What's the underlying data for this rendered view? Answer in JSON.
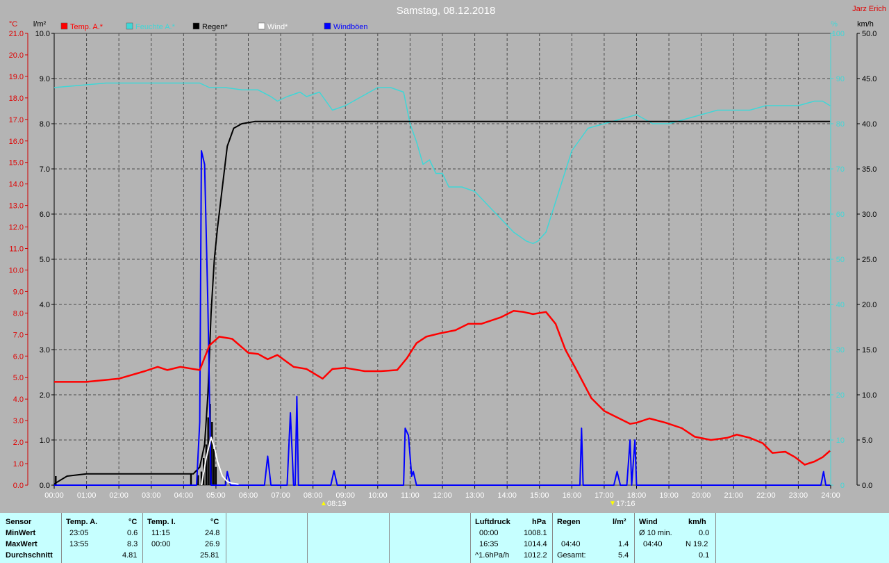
{
  "title": "Samstag, 08.12.2018",
  "author": "Jarz Erich",
  "colors": {
    "bg": "#b4b4b4",
    "temp": "#ff0000",
    "humidity": "#3fd7d7",
    "rain": "#000000",
    "wind": "#ffffff",
    "gust": "#0000ff",
    "stats_bg": "#c6ffff"
  },
  "chart_data": {
    "type": "line",
    "x_axis": {
      "range": [
        "00:00",
        "24:00"
      ],
      "ticks": [
        "00:00",
        "01:00",
        "02:00",
        "03:00",
        "04:00",
        "05:00",
        "06:00",
        "07:00",
        "08:00",
        "09:00",
        "10:00",
        "11:00",
        "12:00",
        "13:00",
        "14:00",
        "15:00",
        "16:00",
        "17:00",
        "18:00",
        "19:00",
        "20:00",
        "21:00",
        "22:00",
        "23:00",
        "24:00"
      ],
      "sunrise": "08:19",
      "sunset": "17:16"
    },
    "y_axes": {
      "temp": {
        "unit": "°C",
        "range": [
          0,
          21
        ],
        "ticks": [
          "0.0",
          "1.0",
          "2.0",
          "3.0",
          "4.0",
          "5.0",
          "6.0",
          "7.0",
          "8.0",
          "9.0",
          "10.0",
          "11.0",
          "12.0",
          "13.0",
          "14.0",
          "15.0",
          "16.0",
          "17.0",
          "18.0",
          "19.0",
          "20.0",
          "21.0"
        ]
      },
      "rain": {
        "unit": "l/m²",
        "range": [
          0,
          10
        ],
        "ticks": [
          "0.0",
          "1.0",
          "2.0",
          "3.0",
          "4.0",
          "5.0",
          "6.0",
          "7.0",
          "8.0",
          "9.0",
          "10.0"
        ]
      },
      "humidity": {
        "unit": "%",
        "range": [
          0,
          100
        ],
        "ticks": [
          "0",
          "10",
          "20",
          "30",
          "40",
          "50",
          "60",
          "70",
          "80",
          "90",
          "100"
        ]
      },
      "wind": {
        "unit": "km/h",
        "range": [
          0,
          50
        ],
        "ticks": [
          "0.0",
          "5.0",
          "10.0",
          "15.0",
          "20.0",
          "25.0",
          "30.0",
          "35.0",
          "40.0",
          "45.0",
          "50.0"
        ]
      }
    },
    "legend": [
      {
        "name": "Temp. A.*",
        "color": "#ff0000"
      },
      {
        "name": "Feuchte A.*",
        "color": "#3fd7d7"
      },
      {
        "name": "Regen*",
        "color": "#000000"
      },
      {
        "name": "Wind*",
        "color": "#ffffff"
      },
      {
        "name": "Windböen",
        "color": "#0000ff"
      }
    ],
    "series": [
      {
        "name": "Temp. A.*",
        "axis": "temp",
        "color": "#ff0000",
        "x": [
          0,
          1,
          2,
          2.8,
          3.2,
          3.5,
          3.9,
          4.5,
          4.8,
          5.1,
          5.5,
          6.0,
          6.3,
          6.6,
          6.9,
          7.4,
          7.8,
          8.3,
          8.6,
          9.0,
          9.6,
          10.1,
          10.6,
          10.9,
          11.2,
          11.5,
          11.9,
          12.4,
          12.8,
          13.2,
          13.8,
          14.2,
          14.5,
          14.8,
          15.2,
          15.5,
          15.8,
          16.2,
          16.6,
          17.0,
          17.4,
          17.8,
          18.0,
          18.4,
          18.9,
          19.4,
          19.8,
          20.3,
          20.8,
          21.1,
          21.5,
          21.9,
          22.2,
          22.6,
          22.9,
          23.2,
          23.5,
          23.75,
          23.98
        ],
        "y": [
          4.8,
          4.8,
          4.95,
          5.3,
          5.5,
          5.35,
          5.5,
          5.35,
          6.5,
          6.9,
          6.8,
          6.15,
          6.1,
          5.85,
          6.05,
          5.5,
          5.4,
          4.95,
          5.4,
          5.45,
          5.3,
          5.3,
          5.35,
          5.9,
          6.6,
          6.9,
          7.05,
          7.2,
          7.5,
          7.5,
          7.8,
          8.1,
          8.05,
          7.95,
          8.05,
          7.5,
          6.3,
          5.2,
          4.05,
          3.45,
          3.15,
          2.85,
          2.9,
          3.1,
          2.9,
          2.65,
          2.25,
          2.1,
          2.2,
          2.35,
          2.2,
          1.95,
          1.5,
          1.55,
          1.3,
          0.95,
          1.1,
          1.3,
          1.6
        ]
      },
      {
        "name": "Feuchte A.*",
        "axis": "humidity",
        "color": "#3fd7d7",
        "x": [
          0,
          0.8,
          1.6,
          2.5,
          3.3,
          4.3,
          4.5,
          4.8,
          5.3,
          5.8,
          6.3,
          6.7,
          6.9,
          7.2,
          7.6,
          7.8,
          8.2,
          8.5,
          8.6,
          9.0,
          9.5,
          10.0,
          10.4,
          10.8,
          11.0,
          11.2,
          11.4,
          11.6,
          11.8,
          12.0,
          12.2,
          12.6,
          13.0,
          13.4,
          13.8,
          14.2,
          14.6,
          14.8,
          14.95,
          15.2,
          15.6,
          16.0,
          16.5,
          17.0,
          17.5,
          18.0,
          18.5,
          19.0,
          19.5,
          20.0,
          20.5,
          21.0,
          21.5,
          22.0,
          22.5,
          23.0,
          23.5,
          23.75,
          23.98
        ],
        "y": [
          88,
          88.5,
          89,
          89,
          89,
          89,
          89,
          88,
          88,
          87.5,
          87.5,
          86,
          85,
          86,
          87,
          86,
          87,
          84,
          83,
          84,
          86,
          88,
          88,
          87,
          80,
          76,
          71,
          72,
          69,
          69,
          66,
          66,
          65,
          62,
          59,
          56,
          54,
          53.5,
          54,
          56,
          65,
          74,
          79,
          80,
          81,
          82,
          80,
          80,
          81,
          82,
          83,
          83,
          83,
          84,
          84,
          84,
          85,
          85,
          84
        ]
      },
      {
        "name": "Regen*",
        "axis": "rain",
        "color": "#000000",
        "x": [
          0,
          0.05,
          0.4,
          1.0,
          2.0,
          3.0,
          4.0,
          4.3,
          4.5,
          4.65,
          4.75,
          4.85,
          4.95,
          5.05,
          5.2,
          5.35,
          5.55,
          5.8,
          6.2,
          7,
          10,
          15,
          20,
          23.98
        ],
        "y": [
          0,
          0.05,
          0.2,
          0.25,
          0.25,
          0.25,
          0.25,
          0.25,
          0.4,
          0.9,
          2.0,
          3.8,
          5.0,
          5.7,
          6.6,
          7.5,
          7.9,
          8.0,
          8.05,
          8.05,
          8.05,
          8.05,
          8.05,
          8.05
        ]
      },
      {
        "name": "Regen-Balken",
        "axis": "rain",
        "color": "#000000",
        "x": [
          0.05,
          4.23,
          4.45,
          4.55,
          4.62,
          4.7,
          4.76,
          4.82,
          4.88,
          4.94,
          5.0,
          5.3
        ],
        "y": [
          0.2,
          0.25,
          0.22,
          0.3,
          0.6,
          0.9,
          1.5,
          1.8,
          1.4,
          0.8,
          0.4,
          0.1
        ]
      },
      {
        "name": "Wind*",
        "axis": "wind",
        "color": "#ffffff",
        "x": [
          4.55,
          4.7,
          4.85,
          4.95,
          5.05,
          5.2,
          5.35,
          5.5,
          5.7
        ],
        "y": [
          0,
          3.0,
          5.3,
          4.2,
          2.6,
          1.0,
          0.4,
          0.2,
          0.1
        ]
      },
      {
        "name": "Windböen",
        "axis": "wind",
        "color": "#0000ff",
        "x": [
          0,
          4.4,
          4.5,
          4.55,
          4.65,
          4.75,
          4.85,
          4.9,
          5.3,
          5.35,
          5.45,
          6.5,
          6.6,
          6.7,
          7.2,
          7.3,
          7.4,
          7.45,
          7.5,
          7.55,
          7.6,
          7.65,
          8.55,
          8.65,
          8.75,
          10.8,
          10.85,
          10.95,
          11.05,
          11.1,
          11.2,
          11.3,
          16.25,
          16.3,
          16.35,
          16.45,
          17.3,
          17.4,
          17.5,
          17.7,
          17.8,
          17.85,
          17.95,
          18.0,
          18.05,
          23.7,
          23.78,
          23.85,
          23.98
        ],
        "y": [
          0,
          0,
          7,
          37,
          35.5,
          20,
          0,
          0,
          0,
          1.5,
          0,
          0,
          3.2,
          0,
          0,
          8,
          0,
          0,
          9.8,
          0,
          0,
          0,
          0,
          1.6,
          0,
          0,
          6.3,
          5.5,
          1,
          1.5,
          0,
          0,
          0,
          6.3,
          0,
          0,
          0,
          1.5,
          0,
          0,
          5,
          0,
          5,
          0,
          0,
          0,
          1.5,
          0,
          0
        ]
      }
    ]
  },
  "stats": {
    "sensor_header": "Sensor",
    "min_label": "MinWert",
    "max_label": "MaxWert",
    "avg_label": "Durchschnitt",
    "temp_a": {
      "header": "Temp. A.",
      "unit": "°C",
      "min_time": "23:05",
      "min_val": "0.6",
      "max_time": "13:55",
      "max_val": "8.3",
      "avg": "4.81"
    },
    "temp_i": {
      "header": "Temp. I.",
      "unit": "°C",
      "min_time": "11:15",
      "min_val": "24.8",
      "max_time": "00:00",
      "max_val": "26.9",
      "avg": "25.81"
    },
    "pressure": {
      "header": "Luftdruck",
      "unit": "hPa",
      "r1_label": "00:00",
      "r1_val": "1008.1",
      "r2_label": "16:35",
      "r2_val": "1014.4",
      "r3_label": "^1.6hPa/h",
      "r3_val": "1012.2"
    },
    "rain": {
      "header": "Regen",
      "unit": "l/m²",
      "r2_label": "04:40",
      "r2_val": "1.4",
      "r3_label": "Gesamt:",
      "r3_val": "5.4"
    },
    "wind": {
      "header": "Wind",
      "unit": "km/h",
      "r1_label": "Ø 10 min.",
      "r1_val": "0.0",
      "r2_label": "04:40",
      "r2_val": "N 19.2",
      "r3_val": "0.1"
    }
  }
}
